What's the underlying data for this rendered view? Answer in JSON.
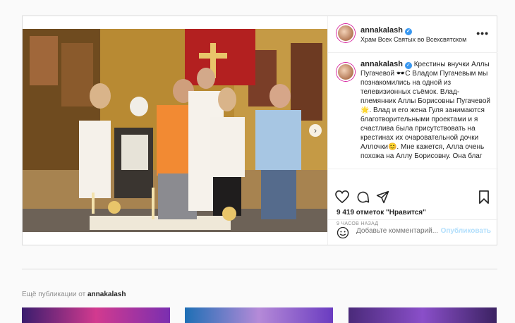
{
  "post": {
    "username": "annakalash",
    "location": "Храм Всех Святых во Всехсвятском",
    "more_label": "•••",
    "caption_username": "annakalash",
    "caption_text": "Крестины внучки Аллы Пугачевой 🕶️С Владом Пугачевым мы познакомились на одной из телевизионных съёмок. Влад-племянник Аллы Борисовны Пугачевой🌟. Влад и его жена Гуля занимаются благотворительными проектами и я счастлива была присутствовать на крестинах их очаровательной дочки Аллочки😊. Мне кажется, Алла очень похожа на Аллу Борисовну. Она благ",
    "likes": "9 419 отметок \"Нравится\"",
    "time": "9 ЧАСОВ НАЗАД",
    "comment_placeholder": "Добавьте комментарий...",
    "publish_label": "Опубликовать",
    "next_arrow": "›"
  },
  "more_posts": {
    "prefix": "Ещё публикации от ",
    "username": "annakalash"
  },
  "colors": {
    "verified": "#3897f0",
    "publish": "#b2dffc",
    "story_ring": "#d6249f"
  }
}
